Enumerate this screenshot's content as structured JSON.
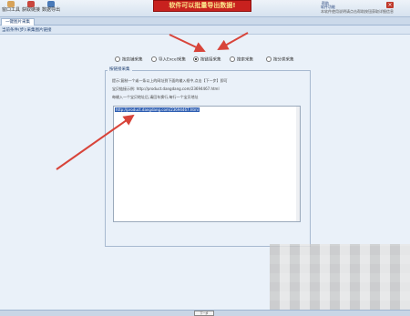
{
  "toolbar": {
    "items": [
      {
        "label": "窗口工具"
      },
      {
        "label": "获取链接"
      },
      {
        "label": "数据导出"
      }
    ],
    "banner_text": "软件可以批量导出数据!",
    "help_text": "帮助",
    "status_text": "软件功能",
    "marquee_text": "本软件使用说明请点击帮助按钮获取详细信息",
    "close_glyph": "×"
  },
  "tabs": [
    {
      "label": "一键图片采集"
    }
  ],
  "breadcrumb": "当前条件(步):采集图片链接",
  "radio_options": [
    {
      "label": "按店铺采集",
      "checked": false
    },
    {
      "label": "导入Excel采集",
      "checked": false
    },
    {
      "label": "按链接采集",
      "checked": true
    },
    {
      "label": "搜索采集",
      "checked": false
    },
    {
      "label": "按分类采集",
      "checked": false
    }
  ],
  "group": {
    "legend": "按链接采集",
    "info_line_1": "提示:复制一个或一条以上的网址到下面的输入框中,点击【下一步】即可",
    "info_line_2": "宝贝链接示例: http://product.dangdang.com/23694467.html",
    "info_line_3": "每输入一个宝贝地址后,请回车换行,每行一个宝贝地址",
    "textarea_value": "http://product.dangdang.com/23694467.html"
  },
  "bottom_button": "下一步",
  "colors": {
    "banner_bg": "#c8211e",
    "banner_text": "#fbe58a",
    "arrow": "#d8443a",
    "selection": "#2f5fb3"
  }
}
